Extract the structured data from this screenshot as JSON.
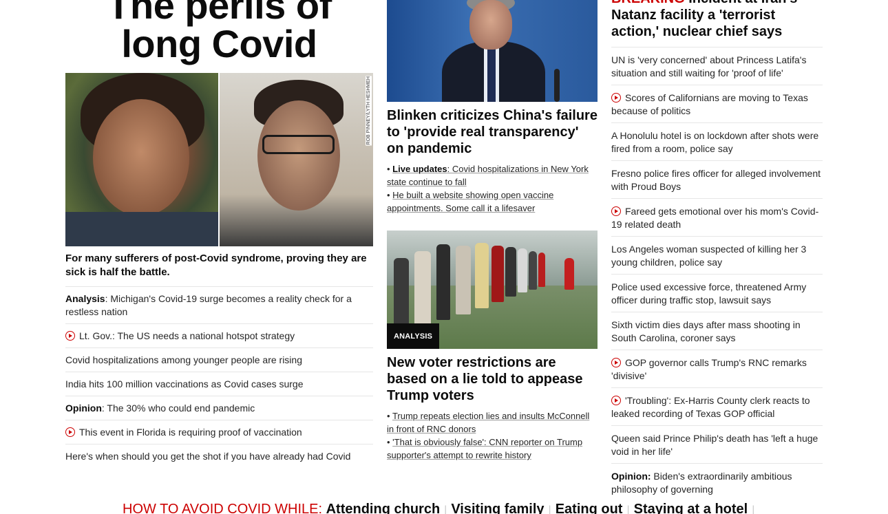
{
  "col1": {
    "headline": "The perils of long Covid",
    "image_credit": "ROB PINNEY/LYTH HESHMEH",
    "subhead": "For many sufferers of post-Covid syndrome, proving they are sick is half the battle.",
    "items": [
      {
        "prefix": "Analysis",
        "text": ": Michigan's Covid-19 surge becomes a reality check for a restless nation",
        "video": false
      },
      {
        "prefix": "",
        "text": "Lt. Gov.: The US needs a national hotspot strategy",
        "video": true
      },
      {
        "prefix": "",
        "text": "Covid hospitalizations among younger people are rising",
        "video": false
      },
      {
        "prefix": "",
        "text": "India hits 100 million vaccinations as Covid cases surge",
        "video": false
      },
      {
        "prefix": "Opinion",
        "text": ": The 30% who could end pandemic",
        "video": false
      },
      {
        "prefix": "",
        "text": "This event in Florida is requiring proof of vaccination",
        "video": true
      },
      {
        "prefix": "",
        "text": "Here's when should you get the shot if you have already had Covid",
        "video": false
      }
    ]
  },
  "col2": {
    "story1": {
      "headline": "Blinken criticizes China's failure to 'provide real transparency' on pandemic",
      "bullets": [
        {
          "bold": "Live updates",
          "text": ": Covid hospitalizations in New York state continue to fall"
        },
        {
          "bold": "",
          "text": "He built a website showing open vaccine appointments. Some call it a lifesaver"
        }
      ]
    },
    "story2": {
      "badge": "ANALYSIS",
      "headline": "New voter restrictions are based on a lie told to appease Trump voters",
      "bullets": [
        {
          "bold": "",
          "text": "Trump repeats election lies and insults McConnell in front of RNC donors"
        },
        {
          "bold": "",
          "text": "'That is obviously false': CNN reporter on Trump supporter's attempt to rewrite history"
        }
      ]
    }
  },
  "col3": {
    "breaking_label": "BREAKING",
    "breaking_text": " Incident at Iran's Natanz facility a 'terrorist action,' nuclear chief says",
    "items": [
      {
        "prefix": "",
        "text": "UN is 'very concerned' about Princess Latifa's situation and still waiting for 'proof of life'",
        "video": false
      },
      {
        "prefix": "",
        "text": "Scores of Californians are moving to Texas because of politics",
        "video": true
      },
      {
        "prefix": "",
        "text": "A Honolulu hotel is on lockdown after shots were fired from a room, police say",
        "video": false
      },
      {
        "prefix": "",
        "text": "Fresno police fires officer for alleged involvement with Proud Boys",
        "video": false
      },
      {
        "prefix": "",
        "text": "Fareed gets emotional over his mom's Covid-19 related death",
        "video": true
      },
      {
        "prefix": "",
        "text": "Los Angeles woman suspected of killing her 3 young children, police say",
        "video": false
      },
      {
        "prefix": "",
        "text": "Police used excessive force, threatened Army officer during traffic stop, lawsuit says",
        "video": false
      },
      {
        "prefix": "",
        "text": "Sixth victim dies days after mass shooting in South Carolina, coroner says",
        "video": false
      },
      {
        "prefix": "",
        "text": "GOP governor calls Trump's RNC remarks 'divisive'",
        "video": true
      },
      {
        "prefix": "",
        "text": "'Troubling': Ex-Harris County clerk reacts to leaked recording of Texas GOP official",
        "video": true
      },
      {
        "prefix": "",
        "text": "Queen said Prince Philip's death has 'left a huge void in her life'",
        "video": false
      },
      {
        "prefix": "Opinion:",
        "text": " Biden's extraordinarily ambitious philosophy of governing",
        "video": false
      }
    ]
  },
  "avoid_bar": {
    "label": "HOW TO AVOID COVID WHILE:",
    "links": [
      "Attending church",
      "Visiting family",
      "Eating out",
      "Staying at a hotel"
    ],
    "separator": "|"
  },
  "colors": {
    "accent_red": "#cc0000",
    "text": "#262626",
    "divider": "#e6e6e6"
  }
}
